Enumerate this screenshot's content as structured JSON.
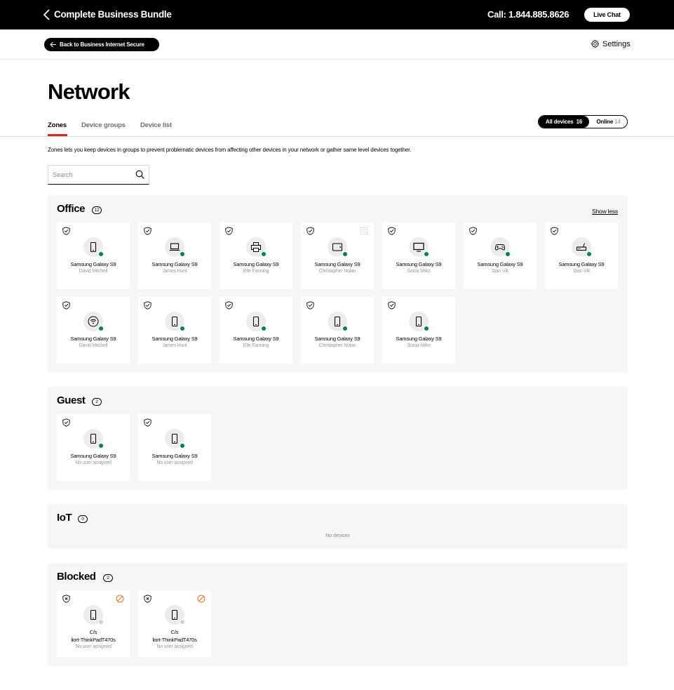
{
  "header": {
    "title": "Complete Business Bundle",
    "call": "Call: 1.844.885.8626",
    "live_chat": "Live Chat"
  },
  "subheader": {
    "back_label": "Back to Business Internet Secure",
    "settings_label": "Settings"
  },
  "page": {
    "title": "Network",
    "tabs": [
      {
        "label": "Zones",
        "active": true
      },
      {
        "label": "Device groups",
        "active": false
      },
      {
        "label": "Device list",
        "active": false
      }
    ],
    "filter": {
      "all_label": "All devices",
      "all_count": "16",
      "online_label": "Online",
      "online_count": "14"
    },
    "description": "Zones lets you keep devices in groups to prevent problematic devices from affecting other devices in your network or gather same level devices together.",
    "search_placeholder": "Search"
  },
  "zones": {
    "office": {
      "title": "Office",
      "count": "12",
      "show_less": "Show less",
      "devices": [
        {
          "name": "Samsung Galaxy S9",
          "user": "David Mitchell",
          "icon": "phone-icon",
          "online": true
        },
        {
          "name": "Samsung Galaxy S9",
          "user": "James Hunt",
          "icon": "laptop-icon",
          "online": true
        },
        {
          "name": "Samsung Galaxy S9",
          "user": "Elle Fanning",
          "icon": "printer-icon",
          "online": true
        },
        {
          "name": "Samsung Galaxy S9",
          "user": "Christopher Nolan",
          "icon": "tablet-icon",
          "online": true
        },
        {
          "name": "Samsung Galaxy S9",
          "user": "Sonia Mrks",
          "icon": "tv-icon",
          "online": true
        },
        {
          "name": "Samsung Galaxy S9",
          "user": "Stan Vik",
          "icon": "gamepad-icon",
          "online": true
        },
        {
          "name": "Samsung Galaxy S9",
          "user": "Stan Vik",
          "icon": "router-icon",
          "online": true
        },
        {
          "name": "Samsung Galaxy S9",
          "user": "David Mitchell",
          "icon": "wifi-icon",
          "online": true
        },
        {
          "name": "Samsung Galaxy S9",
          "user": "James Hunt",
          "icon": "phone-icon",
          "online": true
        },
        {
          "name": "Samsung Galaxy S9",
          "user": "Elle Fanning",
          "icon": "phone-icon",
          "online": true
        },
        {
          "name": "Samsung Galaxy S9",
          "user": "Christopher Nolan",
          "icon": "phone-icon",
          "online": true
        },
        {
          "name": "Samsung Galaxy S9",
          "user": "Sonia Mrks",
          "icon": "phone-icon",
          "online": true
        }
      ]
    },
    "guest": {
      "title": "Guest",
      "count": "2",
      "devices": [
        {
          "name": "Samsung Galaxy S9",
          "user": "No user assigned",
          "icon": "phone-icon",
          "online": true
        },
        {
          "name": "Samsung Galaxy S9",
          "user": "No user assigned",
          "icon": "phone-icon",
          "online": true
        }
      ]
    },
    "iot": {
      "title": "IoT",
      "count": "0",
      "empty_text": "No devices"
    },
    "blocked": {
      "title": "Blocked",
      "count": "2",
      "devices": [
        {
          "name": "C/s",
          "host": "liort-ThinkPadT470s",
          "user": "No user assigned",
          "icon": "phone-icon",
          "online": false
        },
        {
          "name": "C/s",
          "host": "liort-ThinkPadT470s",
          "user": "No user assigned",
          "icon": "phone-icon",
          "online": false
        }
      ]
    }
  },
  "colors": {
    "accent_red": "#d52b1e",
    "online_green": "#00853e",
    "blocked_orange": "#e87722"
  }
}
